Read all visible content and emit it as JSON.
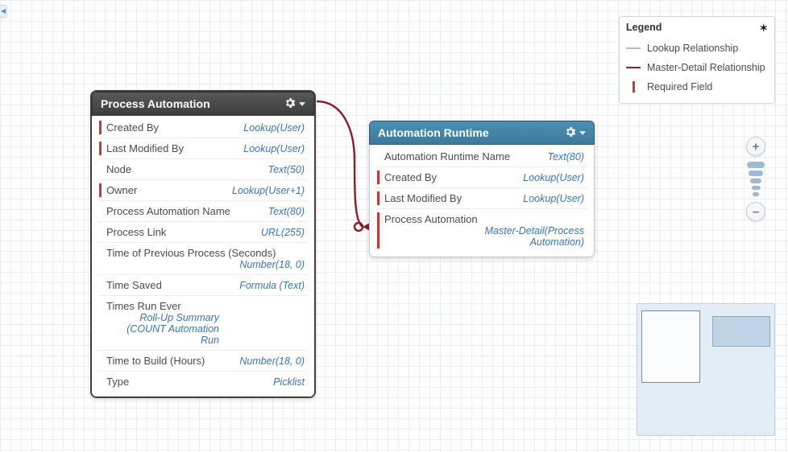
{
  "collapse_glyph": "◀",
  "entities": [
    {
      "title": "Process Automation",
      "fields": [
        {
          "name": "Created By",
          "type": "Lookup(User)",
          "required": true
        },
        {
          "name": "Last Modified By",
          "type": "Lookup(User)",
          "required": true
        },
        {
          "name": "Node",
          "type": "Text(50)",
          "required": false
        },
        {
          "name": "Owner",
          "type": "Lookup(User+1)",
          "required": true
        },
        {
          "name": "Process Automation Name",
          "type": "Text(80)",
          "required": false
        },
        {
          "name": "Process Link",
          "type": "URL(255)",
          "required": false
        },
        {
          "name": "Time of Previous Process (Seconds)",
          "type": "Number(18, 0)",
          "required": false
        },
        {
          "name": "Time Saved",
          "type": "Formula (Text)",
          "required": false
        },
        {
          "name": "Times Run Ever",
          "type": "Roll-Up Summary (COUNT Automation Run",
          "required": false
        },
        {
          "name": "Time to Build (Hours)",
          "type": "Number(18, 0)",
          "required": false
        },
        {
          "name": "Type",
          "type": "Picklist",
          "required": false
        }
      ]
    },
    {
      "title": "Automation Runtime",
      "fields": [
        {
          "name": "Automation Runtime Name",
          "type": "Text(80)",
          "required": false
        },
        {
          "name": "Created By",
          "type": "Lookup(User)",
          "required": true
        },
        {
          "name": "Last Modified By",
          "type": "Lookup(User)",
          "required": true
        },
        {
          "name": "Process Automation",
          "type": "Master-Detail(Process Automation)",
          "required": true
        }
      ]
    }
  ],
  "legend": {
    "title": "Legend",
    "rows": [
      "Lookup Relationship",
      "Master-Detail Relationship",
      "Required Field"
    ]
  },
  "zoom": {
    "in": "+",
    "out": "–"
  }
}
